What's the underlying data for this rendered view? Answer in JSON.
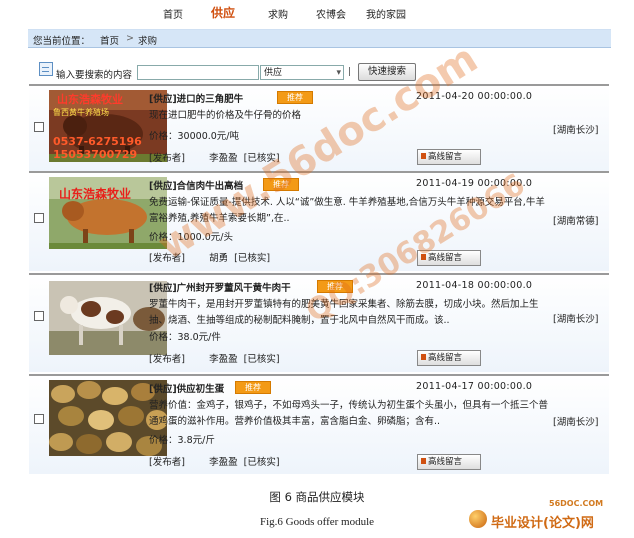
{
  "nav": {
    "items": [
      "首页",
      "供应",
      "求购",
      "农博会",
      "我的家园"
    ],
    "active_index": 1
  },
  "breadcrumb": {
    "prefix": "您当前位置：",
    "home": "首页",
    "separator": ">",
    "current": "求购"
  },
  "search": {
    "label": "输入要搜索的内容",
    "input_value": "",
    "select_value": "供应",
    "separator": "|",
    "button_label": "快速搜索"
  },
  "listings": [
    {
      "title": "[供应]进口的三角肥牛",
      "badge": "推荐",
      "date": "2011-04-20 00:00:00.0",
      "description": "现在进口肥牛的价格及牛仔骨的价格",
      "price_label": "价格：",
      "price": "30000.0元/吨",
      "publisher_label": "[发布者]",
      "publisher": "李盈盈",
      "verified": "[已核实]",
      "message_button": "高线留言",
      "region": "[湖南长沙]",
      "image_text": [
        "山东浩森牧业",
        "鲁西黄牛养殖场",
        "0537-6275196",
        "15053700729"
      ]
    },
    {
      "title": "[供应]合信肉牛出高档",
      "badge": "推荐",
      "date": "2011-04-19 00:00:00.0",
      "description": "免费运输-保证质量-提供技术. 人以“诚”做生意. 牛羊养殖基地,合信万头牛羊种源交易平台,牛羊富裕养殖,养殖牛羊索要长期”,在..",
      "price_label": "价格：",
      "price": "1000.0元/头",
      "publisher_label": "[发布者]",
      "publisher": "胡勇",
      "verified": "[已核实]",
      "message_button": "高线留言",
      "region": "[湖南常德]",
      "image_text": [
        "山东浩森牧业"
      ]
    },
    {
      "title": "[供应]广州封开罗董风干黄牛肉干",
      "badge": "推荐",
      "date": "2011-04-18 00:00:00.0",
      "description": "罗董牛肉干，是用封开罗董镇特有的肥美黄牛回家采集者、除筋去膜，切成小块。然后加上生抽、烧酒、生抽等组成的秘制配料腌制，置于北风中自然风干而成。该..",
      "price_label": "价格：",
      "price": "38.0元/件",
      "publisher_label": "[发布者]",
      "publisher": "李盈盈",
      "verified": "[已核实]",
      "message_button": "高线留言",
      "region": "[湖南长沙]",
      "image_text": []
    },
    {
      "title": "[供应]供应初生蛋",
      "badge": "推荐",
      "date": "2011-04-17 00:00:00.0",
      "description": "营养价值：金鸡子，银鸡子，不如母鸡头一子，传统认为初生蛋个头虽小，但具有一个抵三个普通鸡蛋的滋补作用。营养价值极其丰富，富含脂白金、卵磷脂；含有..",
      "price_label": "价格：",
      "price": "3.8元/斤",
      "publisher_label": "[发布者]",
      "publisher": "李盈盈",
      "verified": "[已核实]",
      "message_button": "高线留言",
      "region": "[湖南长沙]",
      "image_text": []
    }
  ],
  "caption": {
    "cn": "图 6  商品供应模块",
    "en": "Fig.6    Goods offer module"
  },
  "watermarks": [
    "www.56doc.com",
    "QQ:306826066"
  ],
  "logo": {
    "small": "56DOC.COM",
    "text": "毕业设计(论文)网"
  }
}
